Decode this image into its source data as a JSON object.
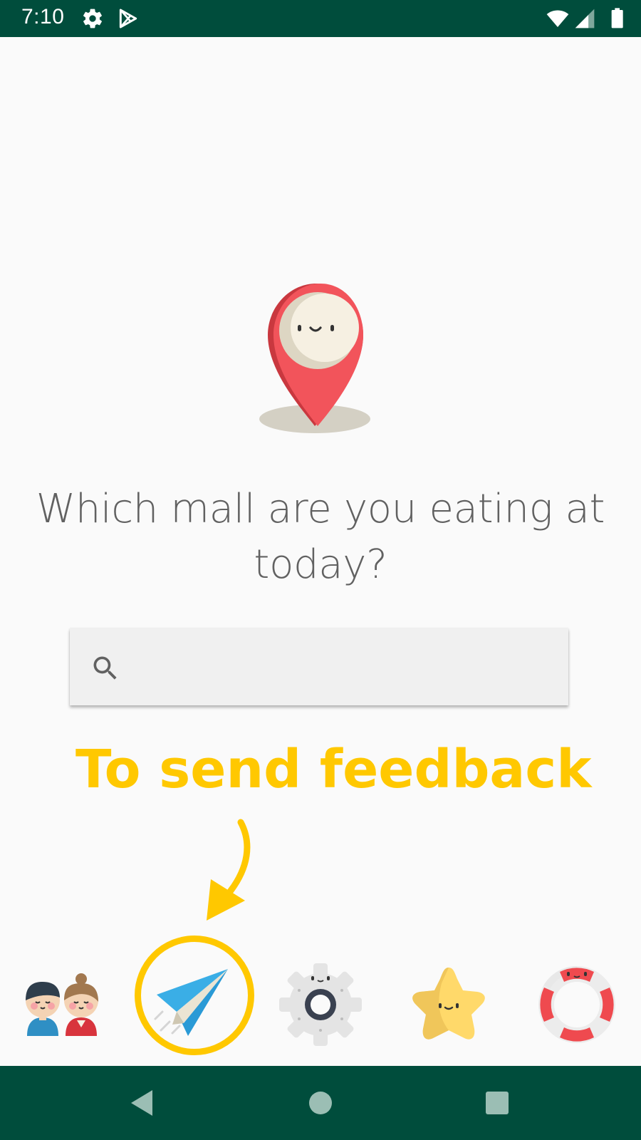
{
  "status_bar": {
    "time": "7:10",
    "icons": [
      "gear-icon",
      "play-store-icon",
      "wifi-icon",
      "signal-icon",
      "battery-icon"
    ]
  },
  "main": {
    "illustration": "map-pin-icon",
    "question": "Which mall are you eating at today?",
    "search": {
      "icon": "search-icon",
      "value": "",
      "placeholder": ""
    }
  },
  "annotation": {
    "text": "To send feedback",
    "color": "#ffc800"
  },
  "bottom_nav": {
    "items": [
      {
        "icon": "people-icon"
      },
      {
        "icon": "paper-plane-icon",
        "highlighted": true
      },
      {
        "icon": "gear-icon"
      },
      {
        "icon": "star-icon"
      },
      {
        "icon": "lifebuoy-icon"
      }
    ]
  },
  "system_nav": {
    "buttons": [
      "back-icon",
      "home-icon",
      "recents-icon"
    ]
  },
  "colors": {
    "status_bar": "#004d3c",
    "background": "#fafafa",
    "accent": "#ffc800",
    "pin": "#f2545b"
  }
}
